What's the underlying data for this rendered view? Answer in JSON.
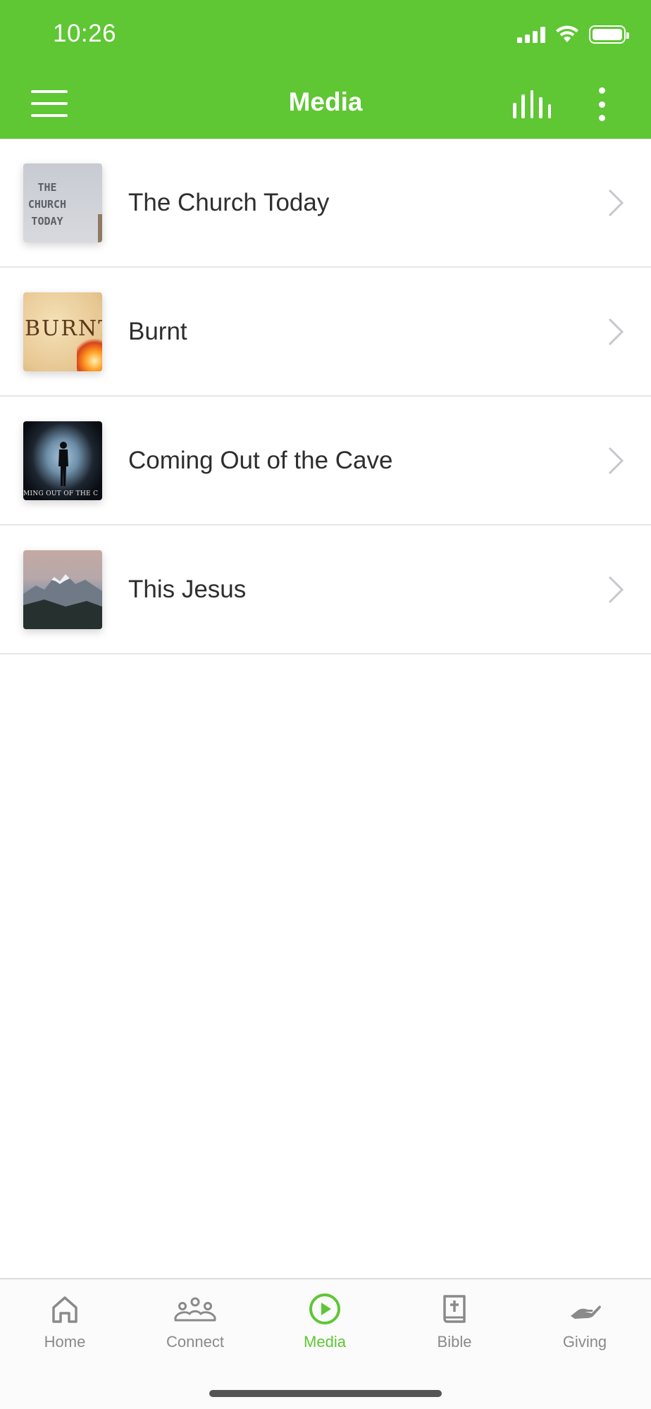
{
  "status_bar": {
    "time": "10:26"
  },
  "header": {
    "title": "Media"
  },
  "media_items": [
    {
      "title": "The Church Today",
      "thumb_text": "THE CHURCH TODAY"
    },
    {
      "title": "Burnt",
      "thumb_text": "BURNT"
    },
    {
      "title": "Coming Out of the Cave",
      "thumb_text": "MING OUT OF THE C"
    },
    {
      "title": "This Jesus"
    }
  ],
  "tabs": [
    {
      "label": "Home",
      "icon": "home-icon"
    },
    {
      "label": "Connect",
      "icon": "people-icon"
    },
    {
      "label": "Media",
      "icon": "play-icon",
      "active": true
    },
    {
      "label": "Bible",
      "icon": "bible-icon"
    },
    {
      "label": "Giving",
      "icon": "giving-hand-icon"
    }
  ],
  "colors": {
    "brand": "#5fc634",
    "tab_inactive": "#8a8a8a",
    "text": "#2e2e2e"
  }
}
